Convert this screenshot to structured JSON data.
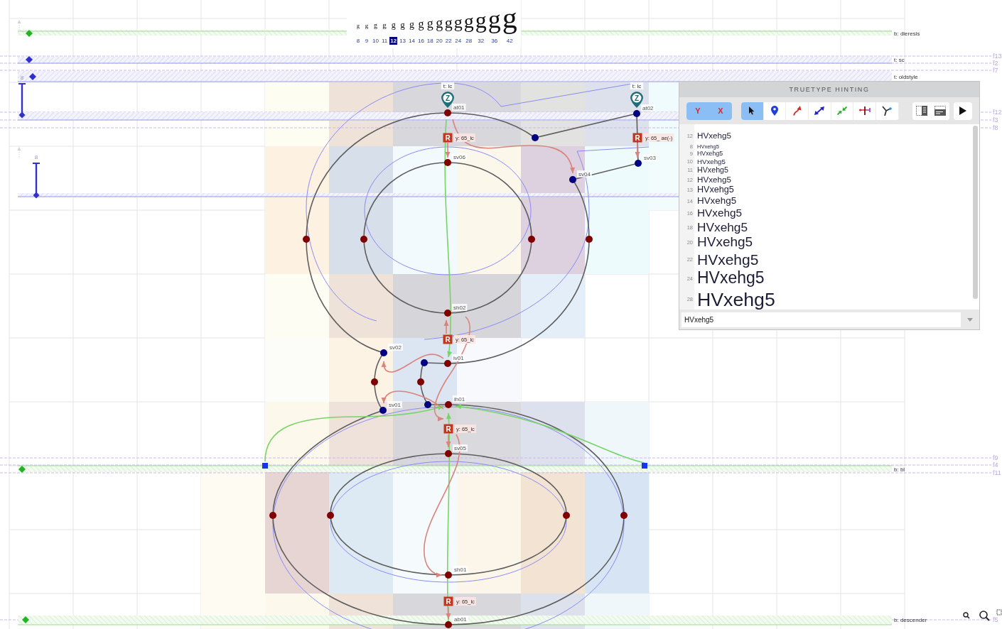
{
  "waterfall": {
    "items": [
      {
        "glyph": "g",
        "size": "8",
        "selected": false
      },
      {
        "glyph": "g",
        "size": "9",
        "selected": false
      },
      {
        "glyph": "g",
        "size": "10",
        "selected": false
      },
      {
        "glyph": "g",
        "size": "11",
        "selected": false
      },
      {
        "glyph": "g",
        "size": "12",
        "selected": true
      },
      {
        "glyph": "g",
        "size": "13",
        "selected": false
      },
      {
        "glyph": "g",
        "size": "14",
        "selected": false
      },
      {
        "glyph": "g",
        "size": "16",
        "selected": false
      },
      {
        "glyph": "g",
        "size": "18",
        "selected": false
      },
      {
        "glyph": "g",
        "size": "20",
        "selected": false
      },
      {
        "glyph": "g",
        "size": "22",
        "selected": false
      },
      {
        "glyph": "g",
        "size": "24",
        "selected": false
      },
      {
        "glyph": "g",
        "size": "28",
        "selected": false
      },
      {
        "glyph": "g",
        "size": "32",
        "selected": false
      },
      {
        "glyph": "g",
        "size": "36",
        "selected": false
      },
      {
        "glyph": "g",
        "size": "42",
        "selected": false
      }
    ]
  },
  "zones": [
    {
      "kind": "bottom",
      "label": "b: dieresis"
    },
    {
      "kind": "top",
      "label": "t: sc"
    },
    {
      "kind": "top",
      "label": "t: oldstyle"
    },
    {
      "kind": "top"
    },
    {
      "kind": "top"
    },
    {
      "kind": "bottom",
      "label": "b: bl"
    },
    {
      "kind": "bottom",
      "label": "b: descender"
    }
  ],
  "stems": [
    {
      "label": "8"
    },
    {
      "label": "8"
    }
  ],
  "guides": [
    {
      "label": "f13"
    },
    {
      "label": "f2"
    },
    {
      "label": "f7"
    },
    {
      "label": "f12"
    },
    {
      "label": "f3"
    },
    {
      "label": "f8"
    },
    {
      "label": "f9"
    },
    {
      "label": "f4"
    },
    {
      "label": "f11"
    },
    {
      "label": "f5"
    }
  ],
  "anchors": [
    {
      "marker": "Z",
      "label": "t: lc"
    },
    {
      "marker": "Z",
      "label": "t: lc"
    }
  ],
  "points": [
    {
      "label": "at01",
      "color": "#800000"
    },
    {
      "label": "at02",
      "color": "#000080"
    },
    {
      "color": "#000080"
    },
    {
      "label": "sv06",
      "color": "#800000"
    },
    {
      "label": "sv03",
      "color": "#000080"
    },
    {
      "label": "sv04",
      "color": "#000080"
    },
    {
      "color": "#800000"
    },
    {
      "color": "#800000"
    },
    {
      "color": "#800000"
    },
    {
      "color": "#800000"
    },
    {
      "label": "sh02",
      "color": "#800000"
    },
    {
      "label": "sv02",
      "color": "#000080"
    },
    {
      "color": "#000080"
    },
    {
      "label": "iv01",
      "color": "#800000"
    },
    {
      "color": "#800000"
    },
    {
      "color": "#800000"
    },
    {
      "label": "sv01",
      "color": "#000080"
    },
    {
      "color": "#000080"
    },
    {
      "label": "ih01",
      "color": "#800000"
    },
    {
      "label": "sv05",
      "color": "#800000"
    },
    {
      "color": "#800000"
    },
    {
      "color": "#800000"
    },
    {
      "color": "#800000"
    },
    {
      "color": "#800000"
    },
    {
      "label": "sh01",
      "color": "#800000"
    },
    {
      "label": "ab01",
      "color": "#800000"
    }
  ],
  "hints": [
    {
      "badge": "R",
      "label": "y: 65_lc"
    },
    {
      "badge": "R",
      "label": "y: 65_ ae(-)"
    },
    {
      "badge": "R",
      "label": "y: 65_lc"
    },
    {
      "badge": "R",
      "label": "y: 65_lc"
    },
    {
      "badge": "R",
      "label": "y: 65_lc"
    }
  ],
  "panel": {
    "title": "TRUETYPE HINTING",
    "axes": [
      {
        "label": "Y",
        "selected": true
      },
      {
        "label": "X",
        "selected": true
      }
    ],
    "tools": [
      {
        "kind": "select",
        "selected": true
      },
      {
        "kind": "anchor",
        "selected": false
      },
      {
        "kind": "align",
        "selected": false
      },
      {
        "kind": "stem",
        "selected": false
      },
      {
        "kind": "inward",
        "selected": false
      },
      {
        "kind": "interpolate",
        "selected": false
      },
      {
        "kind": "delta",
        "selected": false
      }
    ],
    "preview": [
      {
        "size": "12",
        "sample": "HVxehg5"
      },
      {
        "size": "8",
        "sample": "HVxehg5"
      },
      {
        "size": "9",
        "sample": "HVxehg5"
      },
      {
        "size": "10",
        "sample": "HVxehg5"
      },
      {
        "size": "11",
        "sample": "HVxehg5"
      },
      {
        "size": "12",
        "sample": "HVxehg5"
      },
      {
        "size": "13",
        "sample": "HVxehg5"
      },
      {
        "size": "14",
        "sample": "HVxehg5"
      },
      {
        "size": "16",
        "sample": "HVxehg5"
      },
      {
        "size": "18",
        "sample": "HVxehg5"
      },
      {
        "size": "20",
        "sample": "HVxehg5"
      },
      {
        "size": "22",
        "sample": "HVxehg5"
      },
      {
        "size": "24",
        "sample": "HVxehg5"
      },
      {
        "size": "28",
        "sample": "HVxehg5"
      }
    ],
    "sample_field": {
      "value": "HVxehg5"
    }
  }
}
